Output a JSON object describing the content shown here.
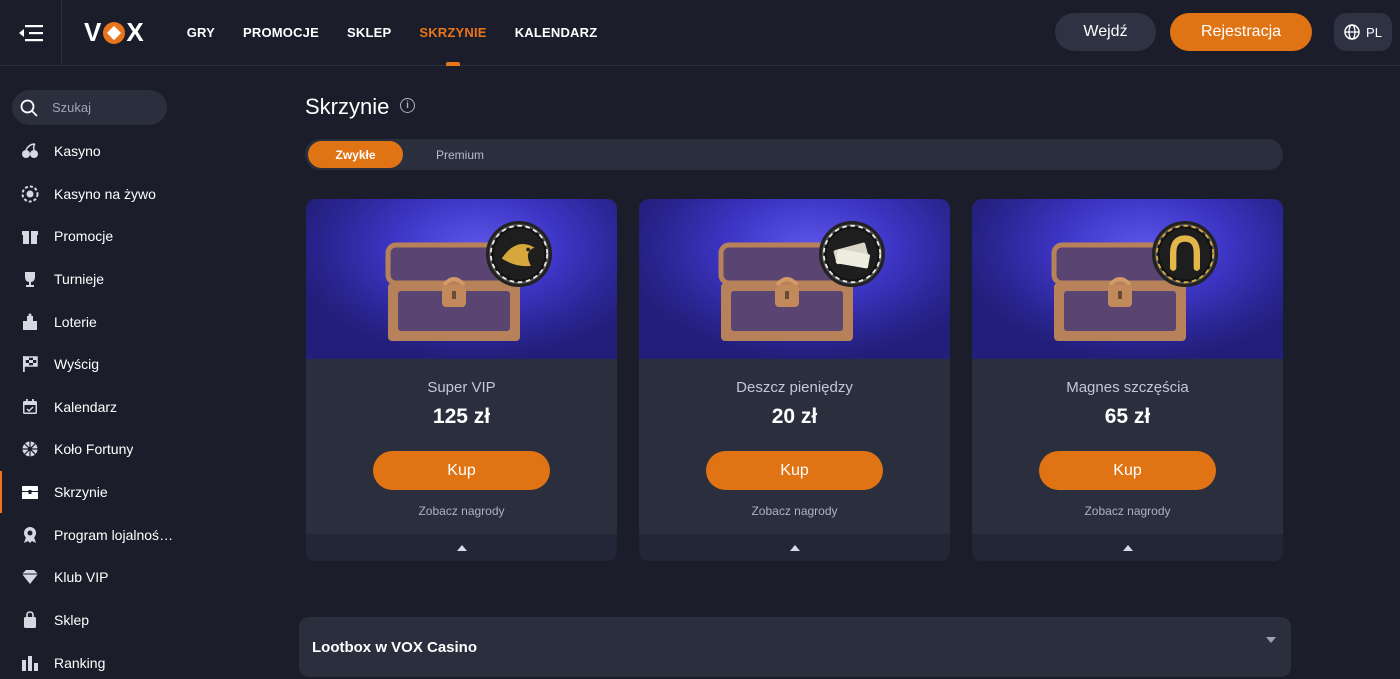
{
  "header": {
    "logo": "VOX",
    "nav": [
      "GRY",
      "PROMOCJE",
      "SKLEP",
      "SKRZYNIE",
      "KALENDARZ"
    ],
    "active_nav": "SKRZYNIE",
    "login_label": "Wejdź",
    "register_label": "Rejestracja",
    "lang_label": "PL"
  },
  "sidebar": {
    "search_placeholder": "Szukaj",
    "items": [
      {
        "label": "Kasyno",
        "icon": "cherries-icon"
      },
      {
        "label": "Kasyno na żywo",
        "icon": "chip-icon"
      },
      {
        "label": "Promocje",
        "icon": "gift-icon"
      },
      {
        "label": "Turnieje",
        "icon": "trophy-icon"
      },
      {
        "label": "Loterie",
        "icon": "lottery-icon"
      },
      {
        "label": "Wyścig",
        "icon": "race-flag-icon"
      },
      {
        "label": "Kalendarz",
        "icon": "calendar-icon"
      },
      {
        "label": "Koło Fortuny",
        "icon": "wheel-icon"
      },
      {
        "label": "Skrzynie",
        "icon": "chest-icon"
      },
      {
        "label": "Program lojalności…",
        "icon": "loyalty-badge-icon"
      },
      {
        "label": "Klub VIP",
        "icon": "diamond-icon"
      },
      {
        "label": "Sklep",
        "icon": "shopping-bag-icon"
      },
      {
        "label": "Ranking",
        "icon": "ranking-bars-icon"
      }
    ],
    "active_item": "Skrzynie"
  },
  "main": {
    "title": "Skrzynie",
    "tabs": [
      {
        "label": "Zwykłe",
        "active": true
      },
      {
        "label": "Premium",
        "active": false
      }
    ],
    "cards": [
      {
        "name": "Super VIP",
        "price": "125 zł",
        "buy_label": "Kup",
        "rewards_label": "Zobacz nagrody",
        "badge": "golden-fish-icon"
      },
      {
        "name": "Deszcz pieniędzy",
        "price": "20 zł",
        "buy_label": "Kup",
        "rewards_label": "Zobacz nagrody",
        "badge": "money-stack-icon"
      },
      {
        "name": "Magnes szczęścia",
        "price": "65 zł",
        "buy_label": "Kup",
        "rewards_label": "Zobacz nagrody",
        "badge": "horseshoe-icon"
      }
    ],
    "accordion_title": "Lootbox w VOX Casino"
  },
  "colors": {
    "accent": "#e07415",
    "background": "#1b1d2a",
    "panel": "#2b2e3d",
    "card_top": "#3d35c4"
  }
}
